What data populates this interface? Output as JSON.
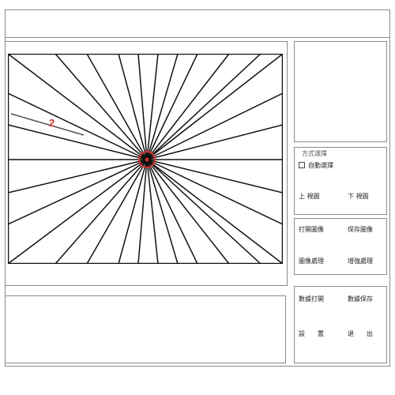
{
  "window": {},
  "options_panel": {
    "group_title": "方式選擇",
    "checkbox_label": "自動選擇",
    "left_label": "上 視圖",
    "right_label": "下 視圖"
  },
  "controls_panel_1": {
    "items": [
      "打開圖像",
      "保存圖像",
      "圖像處理",
      "增強處理"
    ]
  },
  "controls_panel_2": {
    "items": [
      "數據打開",
      "數據保存",
      "設",
      "置",
      "退",
      "出"
    ]
  },
  "canvas": {
    "ray_count": 32,
    "stroke_color": "#111111",
    "marker_color": "#d0312d",
    "marker_glyph": "2"
  }
}
